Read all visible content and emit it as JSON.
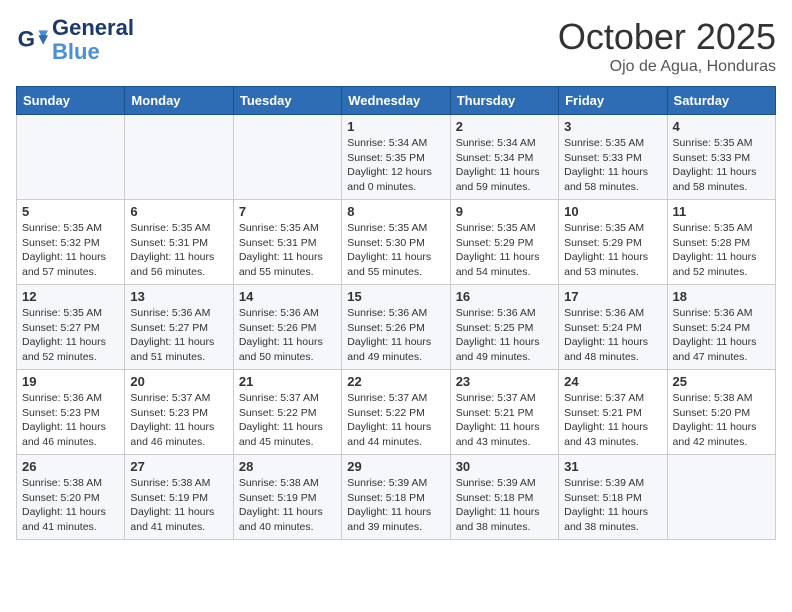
{
  "logo": {
    "line1": "General",
    "line2": "Blue"
  },
  "title": "October 2025",
  "subtitle": "Ojo de Agua, Honduras",
  "headers": [
    "Sunday",
    "Monday",
    "Tuesday",
    "Wednesday",
    "Thursday",
    "Friday",
    "Saturday"
  ],
  "weeks": [
    [
      {
        "day": "",
        "info": ""
      },
      {
        "day": "",
        "info": ""
      },
      {
        "day": "",
        "info": ""
      },
      {
        "day": "1",
        "info": "Sunrise: 5:34 AM\nSunset: 5:35 PM\nDaylight: 12 hours and 0 minutes."
      },
      {
        "day": "2",
        "info": "Sunrise: 5:34 AM\nSunset: 5:34 PM\nDaylight: 11 hours and 59 minutes."
      },
      {
        "day": "3",
        "info": "Sunrise: 5:35 AM\nSunset: 5:33 PM\nDaylight: 11 hours and 58 minutes."
      },
      {
        "day": "4",
        "info": "Sunrise: 5:35 AM\nSunset: 5:33 PM\nDaylight: 11 hours and 58 minutes."
      }
    ],
    [
      {
        "day": "5",
        "info": "Sunrise: 5:35 AM\nSunset: 5:32 PM\nDaylight: 11 hours and 57 minutes."
      },
      {
        "day": "6",
        "info": "Sunrise: 5:35 AM\nSunset: 5:31 PM\nDaylight: 11 hours and 56 minutes."
      },
      {
        "day": "7",
        "info": "Sunrise: 5:35 AM\nSunset: 5:31 PM\nDaylight: 11 hours and 55 minutes."
      },
      {
        "day": "8",
        "info": "Sunrise: 5:35 AM\nSunset: 5:30 PM\nDaylight: 11 hours and 55 minutes."
      },
      {
        "day": "9",
        "info": "Sunrise: 5:35 AM\nSunset: 5:29 PM\nDaylight: 11 hours and 54 minutes."
      },
      {
        "day": "10",
        "info": "Sunrise: 5:35 AM\nSunset: 5:29 PM\nDaylight: 11 hours and 53 minutes."
      },
      {
        "day": "11",
        "info": "Sunrise: 5:35 AM\nSunset: 5:28 PM\nDaylight: 11 hours and 52 minutes."
      }
    ],
    [
      {
        "day": "12",
        "info": "Sunrise: 5:35 AM\nSunset: 5:27 PM\nDaylight: 11 hours and 52 minutes."
      },
      {
        "day": "13",
        "info": "Sunrise: 5:36 AM\nSunset: 5:27 PM\nDaylight: 11 hours and 51 minutes."
      },
      {
        "day": "14",
        "info": "Sunrise: 5:36 AM\nSunset: 5:26 PM\nDaylight: 11 hours and 50 minutes."
      },
      {
        "day": "15",
        "info": "Sunrise: 5:36 AM\nSunset: 5:26 PM\nDaylight: 11 hours and 49 minutes."
      },
      {
        "day": "16",
        "info": "Sunrise: 5:36 AM\nSunset: 5:25 PM\nDaylight: 11 hours and 49 minutes."
      },
      {
        "day": "17",
        "info": "Sunrise: 5:36 AM\nSunset: 5:24 PM\nDaylight: 11 hours and 48 minutes."
      },
      {
        "day": "18",
        "info": "Sunrise: 5:36 AM\nSunset: 5:24 PM\nDaylight: 11 hours and 47 minutes."
      }
    ],
    [
      {
        "day": "19",
        "info": "Sunrise: 5:36 AM\nSunset: 5:23 PM\nDaylight: 11 hours and 46 minutes."
      },
      {
        "day": "20",
        "info": "Sunrise: 5:37 AM\nSunset: 5:23 PM\nDaylight: 11 hours and 46 minutes."
      },
      {
        "day": "21",
        "info": "Sunrise: 5:37 AM\nSunset: 5:22 PM\nDaylight: 11 hours and 45 minutes."
      },
      {
        "day": "22",
        "info": "Sunrise: 5:37 AM\nSunset: 5:22 PM\nDaylight: 11 hours and 44 minutes."
      },
      {
        "day": "23",
        "info": "Sunrise: 5:37 AM\nSunset: 5:21 PM\nDaylight: 11 hours and 43 minutes."
      },
      {
        "day": "24",
        "info": "Sunrise: 5:37 AM\nSunset: 5:21 PM\nDaylight: 11 hours and 43 minutes."
      },
      {
        "day": "25",
        "info": "Sunrise: 5:38 AM\nSunset: 5:20 PM\nDaylight: 11 hours and 42 minutes."
      }
    ],
    [
      {
        "day": "26",
        "info": "Sunrise: 5:38 AM\nSunset: 5:20 PM\nDaylight: 11 hours and 41 minutes."
      },
      {
        "day": "27",
        "info": "Sunrise: 5:38 AM\nSunset: 5:19 PM\nDaylight: 11 hours and 41 minutes."
      },
      {
        "day": "28",
        "info": "Sunrise: 5:38 AM\nSunset: 5:19 PM\nDaylight: 11 hours and 40 minutes."
      },
      {
        "day": "29",
        "info": "Sunrise: 5:39 AM\nSunset: 5:18 PM\nDaylight: 11 hours and 39 minutes."
      },
      {
        "day": "30",
        "info": "Sunrise: 5:39 AM\nSunset: 5:18 PM\nDaylight: 11 hours and 38 minutes."
      },
      {
        "day": "31",
        "info": "Sunrise: 5:39 AM\nSunset: 5:18 PM\nDaylight: 11 hours and 38 minutes."
      },
      {
        "day": "",
        "info": ""
      }
    ]
  ]
}
